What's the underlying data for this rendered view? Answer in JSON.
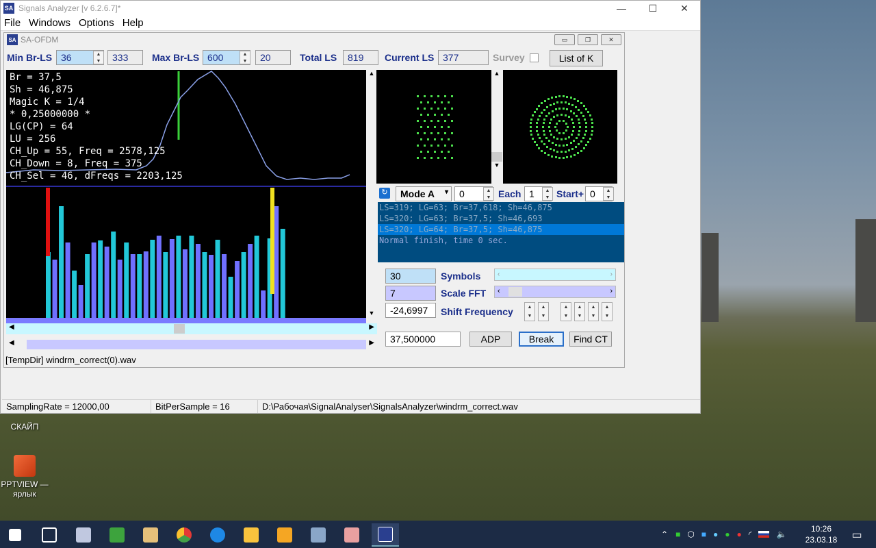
{
  "desktop": {
    "icons": [
      {
        "label": "СКАЙП"
      },
      {
        "label1": "PPTVIEW —",
        "label2": "ярлык"
      }
    ]
  },
  "window": {
    "title": "Signals Analyzer [v 6.2.6.7]*",
    "logo": "SA",
    "menu": [
      "File",
      "Windows",
      "Options",
      "Help"
    ],
    "controls": {
      "minimize": "—",
      "maximize": "☐",
      "close": "✕"
    }
  },
  "child": {
    "title": "SA-OFDM",
    "logo": "SA",
    "min_br_ls_label": "Min Br-LS",
    "min_br_ls": "36",
    "min_br_ls2": "333",
    "max_br_ls_label": "Max Br-LS",
    "max_br_ls": "600",
    "max_br_ls2": "20",
    "total_ls_label": "Total LS",
    "total_ls": "819",
    "current_ls_label": "Current LS",
    "current_ls": "377",
    "survey_label": "Survey",
    "list_of_k": "List of K",
    "graph_text": [
      "Br = 37,5",
      "Sh = 46,875",
      "Magic K = 1/4",
      "* 0,25000000 *",
      "LG(CP) = 64",
      "LU = 256",
      "CH_Up = 55, Freq = 2578,125",
      "CH_Down = 8, Freq = 375",
      "CH_Sel = 46, dFreqs = 2203,125"
    ],
    "mode": "Mode A",
    "mode_value": "0",
    "each_label": "Each",
    "each": "1",
    "start_label": "Start+",
    "start": "0",
    "log": [
      "LS=319; LG=63; Br=37,618; Sh=46,875",
      "LS=320; LG=63; Br=37,5; Sh=46,693",
      "LS=320; LG=64; Br=37,5; Sh=46,875",
      "Normal finish, time 0 sec."
    ],
    "symbols_value": "30",
    "symbols_label": "Symbols",
    "scale_fft_value": "7",
    "scale_fft_label": "Scale FFT",
    "shift_value": "-24,6997",
    "shift_label": "Shift Frequency",
    "br_value": "37,500000",
    "adp": "ADP",
    "break": "Break",
    "find_ct": "Find CT",
    "file": "[TempDir] windrm_correct(0).wav"
  },
  "status": {
    "sampling": "SamplingRate = 12000,00",
    "bits": "BitPerSample = 16",
    "path": "D:\\Рабочая\\SignalAnalyser\\SignalsAnalyzer\\windrm_correct.wav"
  },
  "taskbar": {
    "time": "10:26",
    "date": "23.03.18"
  },
  "chart_data": {
    "type": "bar",
    "values": [
      96,
      85,
      163,
      110,
      69,
      48,
      93,
      110,
      113,
      104,
      126,
      85,
      110,
      93,
      93,
      97,
      114,
      120,
      96,
      115,
      120,
      100,
      120,
      108,
      96,
      92,
      114,
      93,
      60,
      83,
      96,
      108,
      120,
      40,
      116,
      163,
      130
    ]
  }
}
